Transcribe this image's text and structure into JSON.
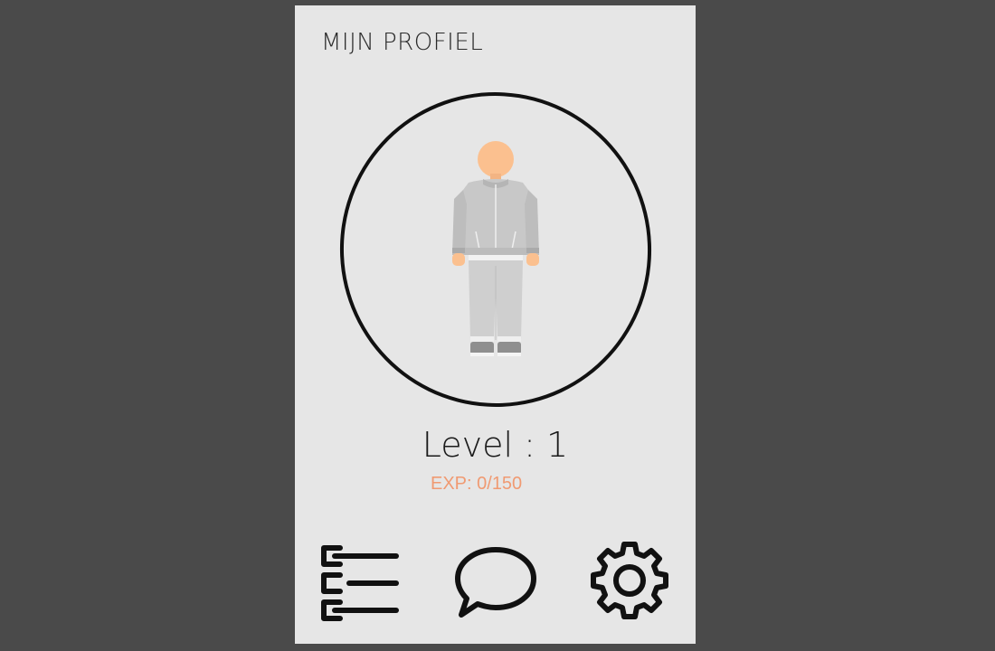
{
  "header": {
    "title": "MIJN PROFIEL"
  },
  "profile": {
    "level_text": "Level : 1",
    "exp_text": "EXP: 0/150",
    "exp_current": 0,
    "exp_max": 150
  },
  "nav": {
    "items": [
      {
        "icon": "checklist-icon"
      },
      {
        "icon": "chat-bubble-icon"
      },
      {
        "icon": "gear-icon"
      }
    ]
  },
  "colors": {
    "background": "#4a4a4a",
    "panel": "#e6e6e6",
    "exp_accent": "#f09a72",
    "skin": "#fbc08f",
    "clothing": "#c8c8c8"
  }
}
